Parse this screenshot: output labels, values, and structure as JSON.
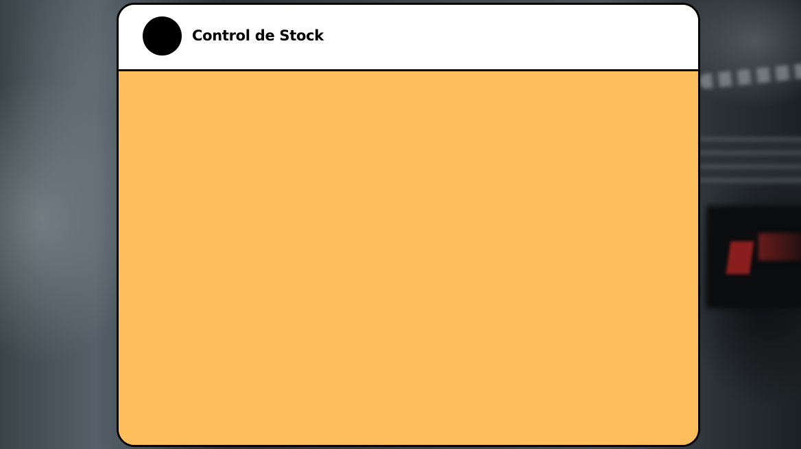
{
  "header": {
    "title": "Control de Stock",
    "avatar_icon": "avatar-circle"
  },
  "colors": {
    "card_header_bg": "#ffffff",
    "card_body_bg": "#ffbe5c",
    "border": "#000000",
    "avatar": "#000000"
  }
}
